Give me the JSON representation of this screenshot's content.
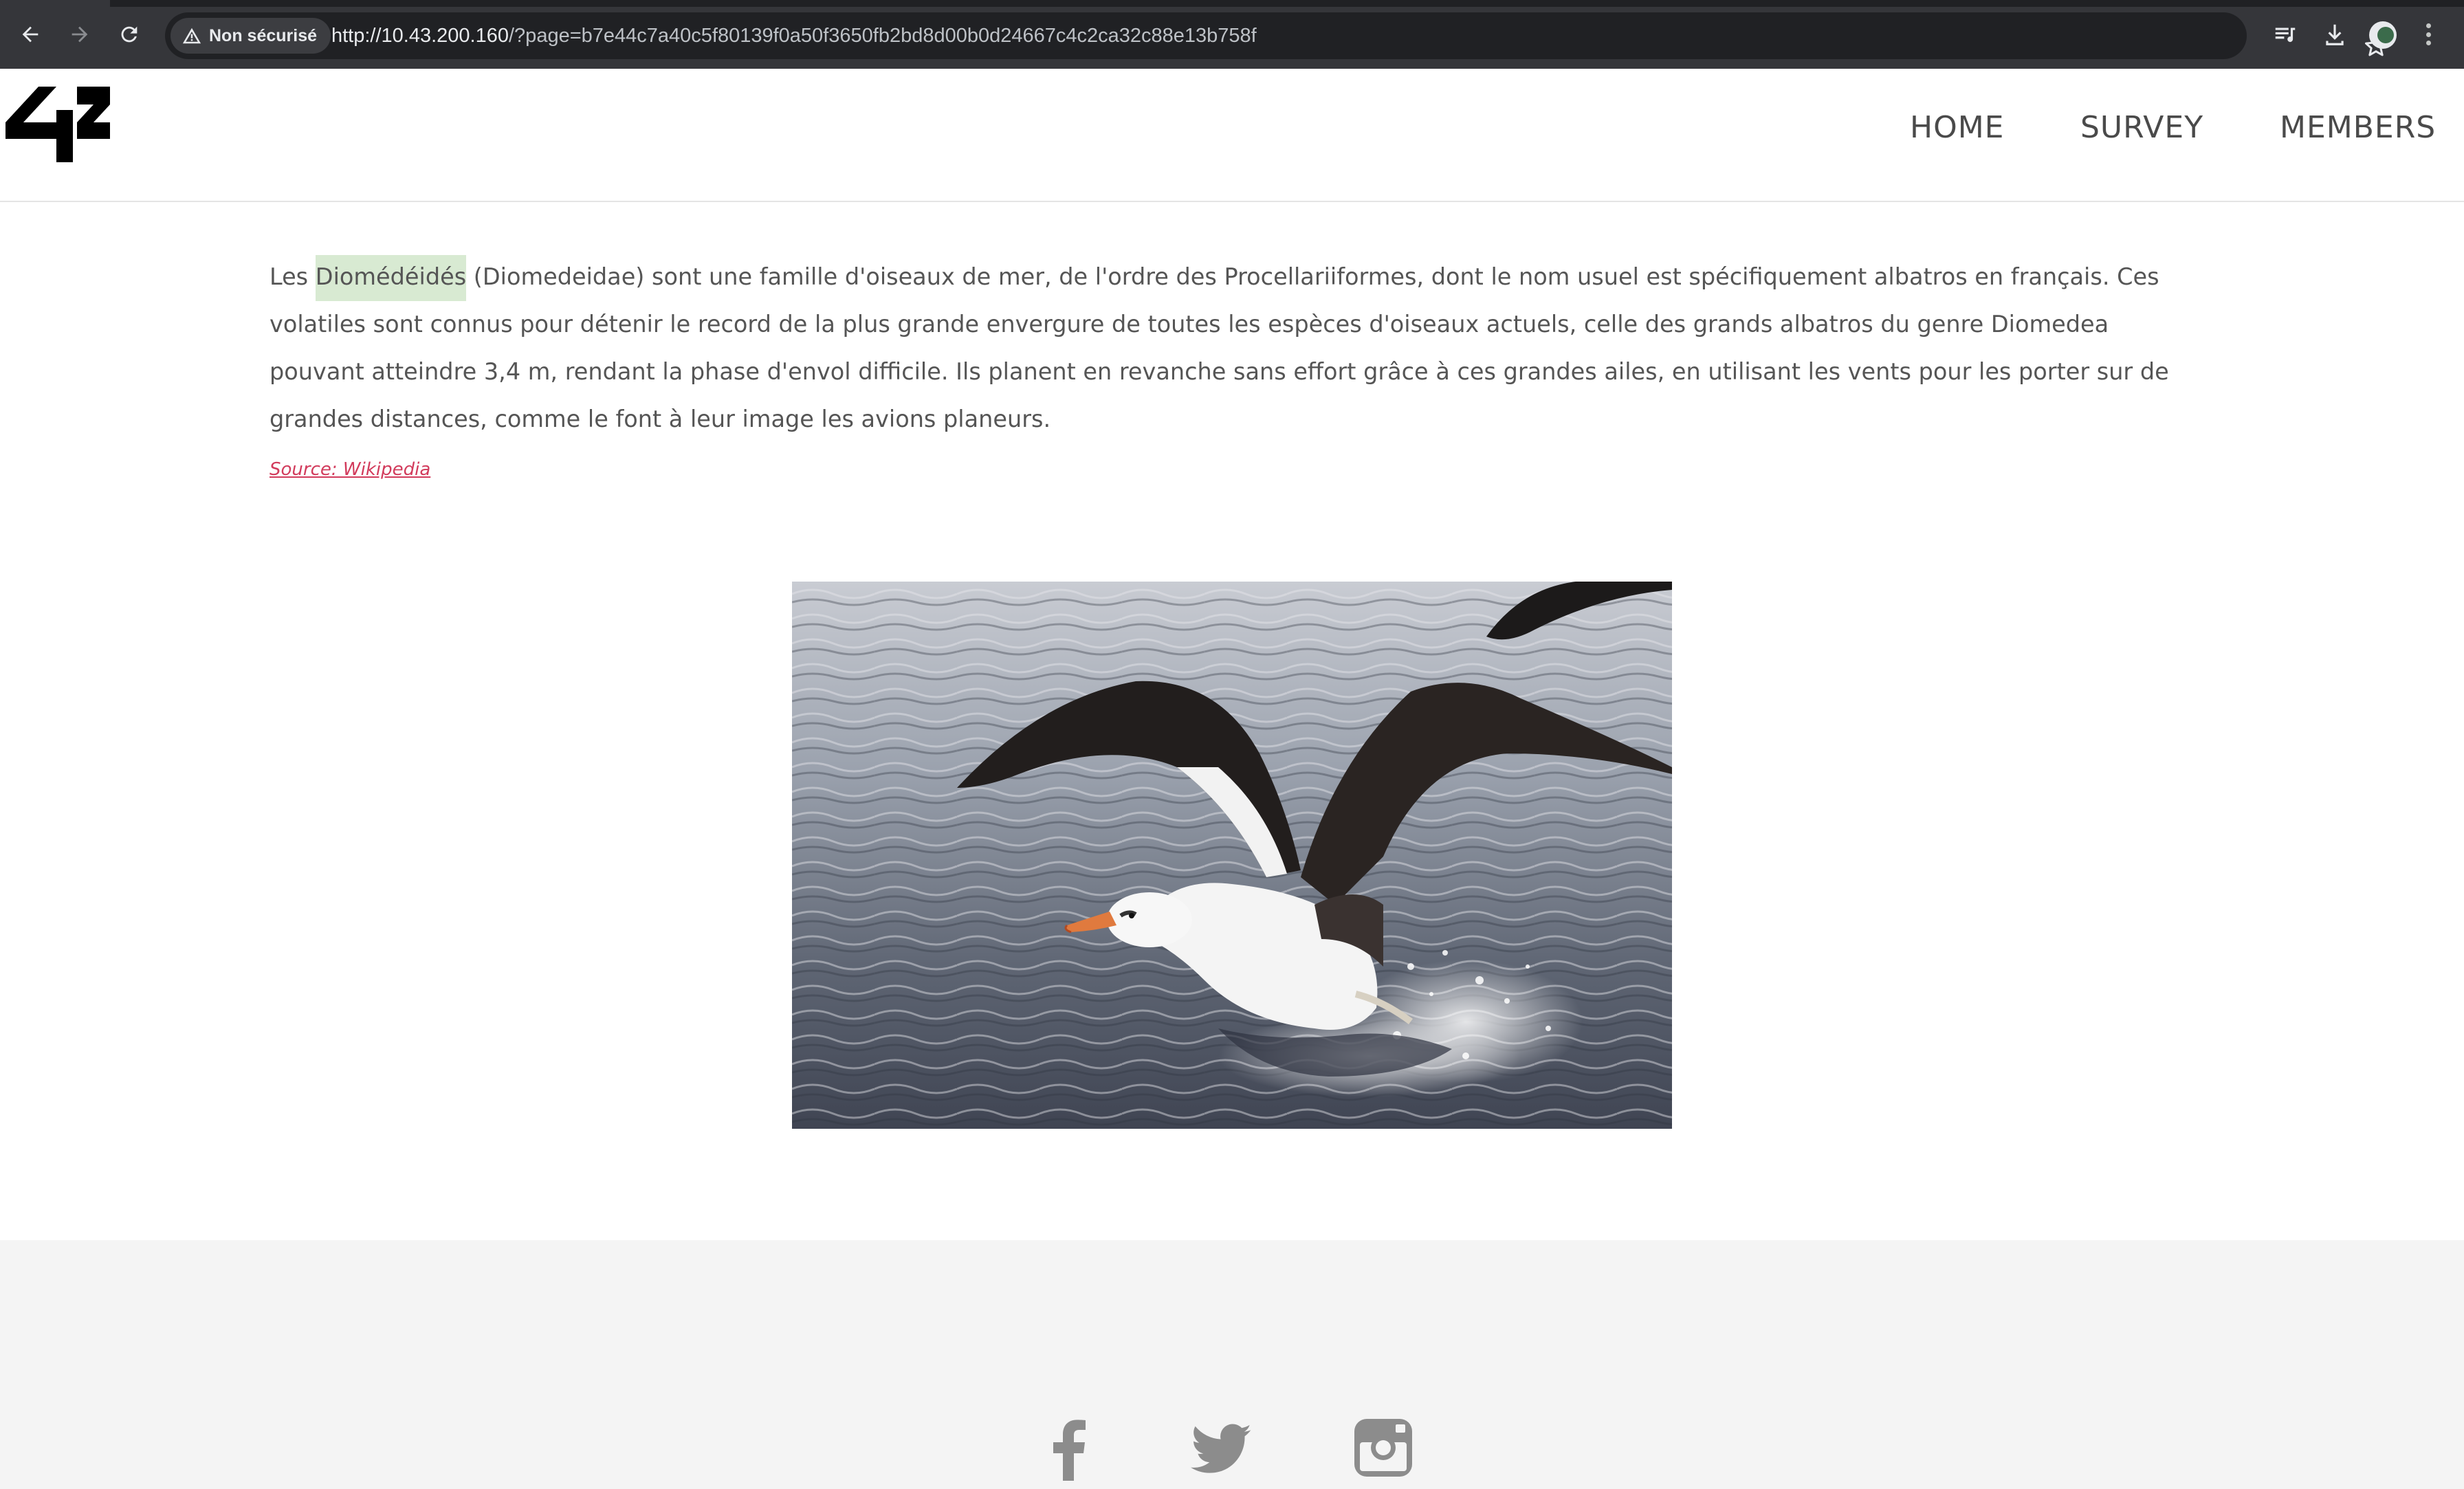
{
  "browser": {
    "security_label": "Non sécurisé",
    "url_host": "http://10.43.200.160",
    "url_path": "/?page=b7e44c7a40c5f80139f0a50f3650fb2bd8d00b0d24667c4c2ca32c88e13b758f",
    "icons": [
      "back-arrow-icon",
      "forward-arrow-icon",
      "reload-icon",
      "warning-icon",
      "star-icon",
      "media-queue-icon",
      "download-icon",
      "profile-avatar",
      "more-vert-icon"
    ]
  },
  "header": {
    "logo_text": "42",
    "nav": [
      "HOME",
      "SURVEY",
      "MEMBERS"
    ]
  },
  "article": {
    "lead_word": "Les",
    "highlight": "Diomédéidés",
    "body": " (Diomedeidae) sont une famille d'oiseaux de mer, de l'ordre des Procellariiformes, dont le nom usuel est spécifiquement albatros en français. Ces volatiles sont connus pour détenir le record de la plus grande envergure de toutes les espèces d'oiseaux actuels, celle des grands albatros du genre Diomedea pouvant atteindre 3,4 m, rendant la phase d'envol difficile. Ils planent en revanche sans effort grâce à ces grandes ailes, en utilisant les vents pour les porter sur de grandes distances, comme le font à leur image les avions planeurs.",
    "source": "Source: Wikipedia"
  },
  "footer": {
    "social_icons": [
      "facebook-icon",
      "twitter-icon",
      "instagram-icon"
    ]
  },
  "colors": {
    "chrome_bg": "#35363a",
    "omnibox_bg": "#202124",
    "highlight_bg": "#d8ead2",
    "source_link": "#d23b5c",
    "footer_bg": "#f4f4f4",
    "social_icon": "#8c8c8c"
  }
}
